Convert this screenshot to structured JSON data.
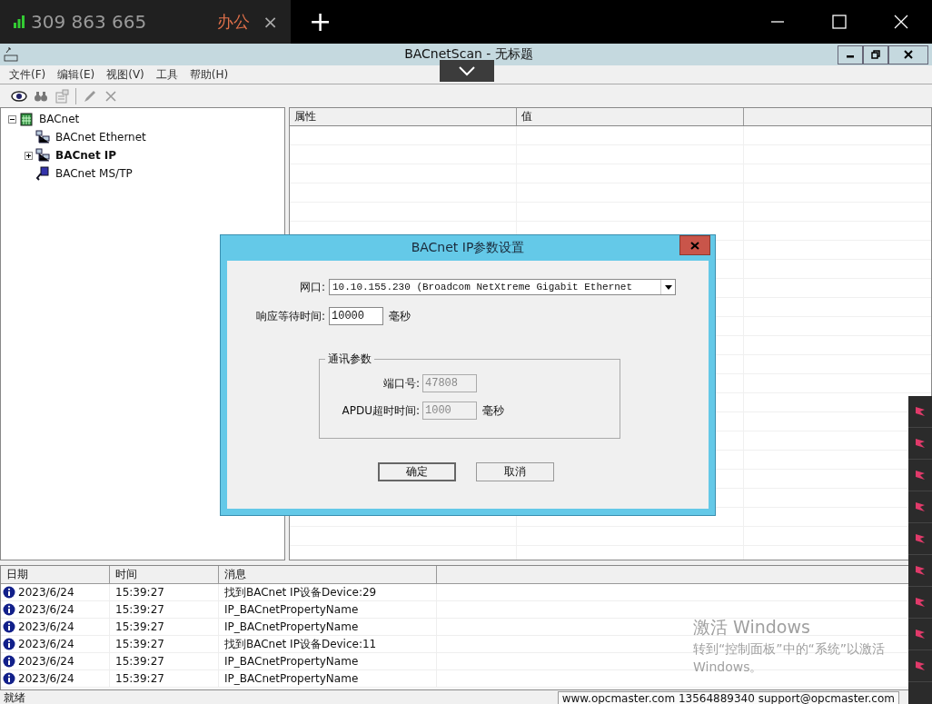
{
  "top_bar": {
    "signal_text": "309 863 665",
    "tab": {
      "label": "办公",
      "close": "×"
    },
    "new_tab": "+"
  },
  "window": {
    "title": "BACnetScan - 无标题"
  },
  "menu": [
    "文件(F)",
    "编辑(E)",
    "视图(V)",
    "工具",
    "帮助(H)"
  ],
  "remote_toolbar": {
    "expanded": false
  },
  "tree": [
    {
      "label": "BACnet",
      "kind": "root",
      "expanded": true,
      "selected": false,
      "children": [
        {
          "label": "BACnet Ethernet",
          "kind": "network",
          "selected": false
        },
        {
          "label": "BACnet IP",
          "kind": "network",
          "expanded": false,
          "selected": true
        },
        {
          "label": "BACnet MS/TP",
          "kind": "serial",
          "selected": false
        }
      ]
    }
  ],
  "properties_table": {
    "columns": [
      "属性",
      "值"
    ]
  },
  "dialog": {
    "title": "BACnet IP参数设置",
    "fields": [
      {
        "kind": "select",
        "label": "网口:",
        "value": "10.10.155.230 (Broadcom NetXtreme Gigabit Ethernet"
      },
      {
        "kind": "text",
        "label": "响应等待时间:",
        "value": "10000",
        "unit": "毫秒"
      }
    ],
    "group": {
      "title": "通讯参数",
      "fields": [
        {
          "label": "端口号:",
          "value": "47808",
          "disabled": true
        },
        {
          "label": "APDU超时时间:",
          "value": "1000",
          "unit": "毫秒",
          "disabled": true
        }
      ]
    },
    "buttons": [
      {
        "label": "确定",
        "default": true
      },
      {
        "label": "取消",
        "default": false
      }
    ]
  },
  "log": {
    "columns": [
      "日期",
      "时间",
      "消息"
    ],
    "rows": [
      {
        "date": "2023/6/24",
        "time": "15:39:27",
        "message": "找到BACnet IP设备Device:29"
      },
      {
        "date": "2023/6/24",
        "time": "15:39:27",
        "message": "IP_BACnetPropertyName"
      },
      {
        "date": "2023/6/24",
        "time": "15:39:27",
        "message": "IP_BACnetPropertyName"
      },
      {
        "date": "2023/6/24",
        "time": "15:39:27",
        "message": "找到BACnet IP设备Device:11"
      },
      {
        "date": "2023/6/24",
        "time": "15:39:27",
        "message": "IP_BACnetPropertyName"
      },
      {
        "date": "2023/6/24",
        "time": "15:39:27",
        "message": "IP_BACnetPropertyName"
      }
    ]
  },
  "activation_notice": {
    "title": "激活 Windows",
    "text": "转到“控制面板”中的“系统”以激活Windows。"
  },
  "status_bar": {
    "text": "就绪",
    "info": "www.opcmaster.com 13564889340 support@opcmaster.com"
  }
}
